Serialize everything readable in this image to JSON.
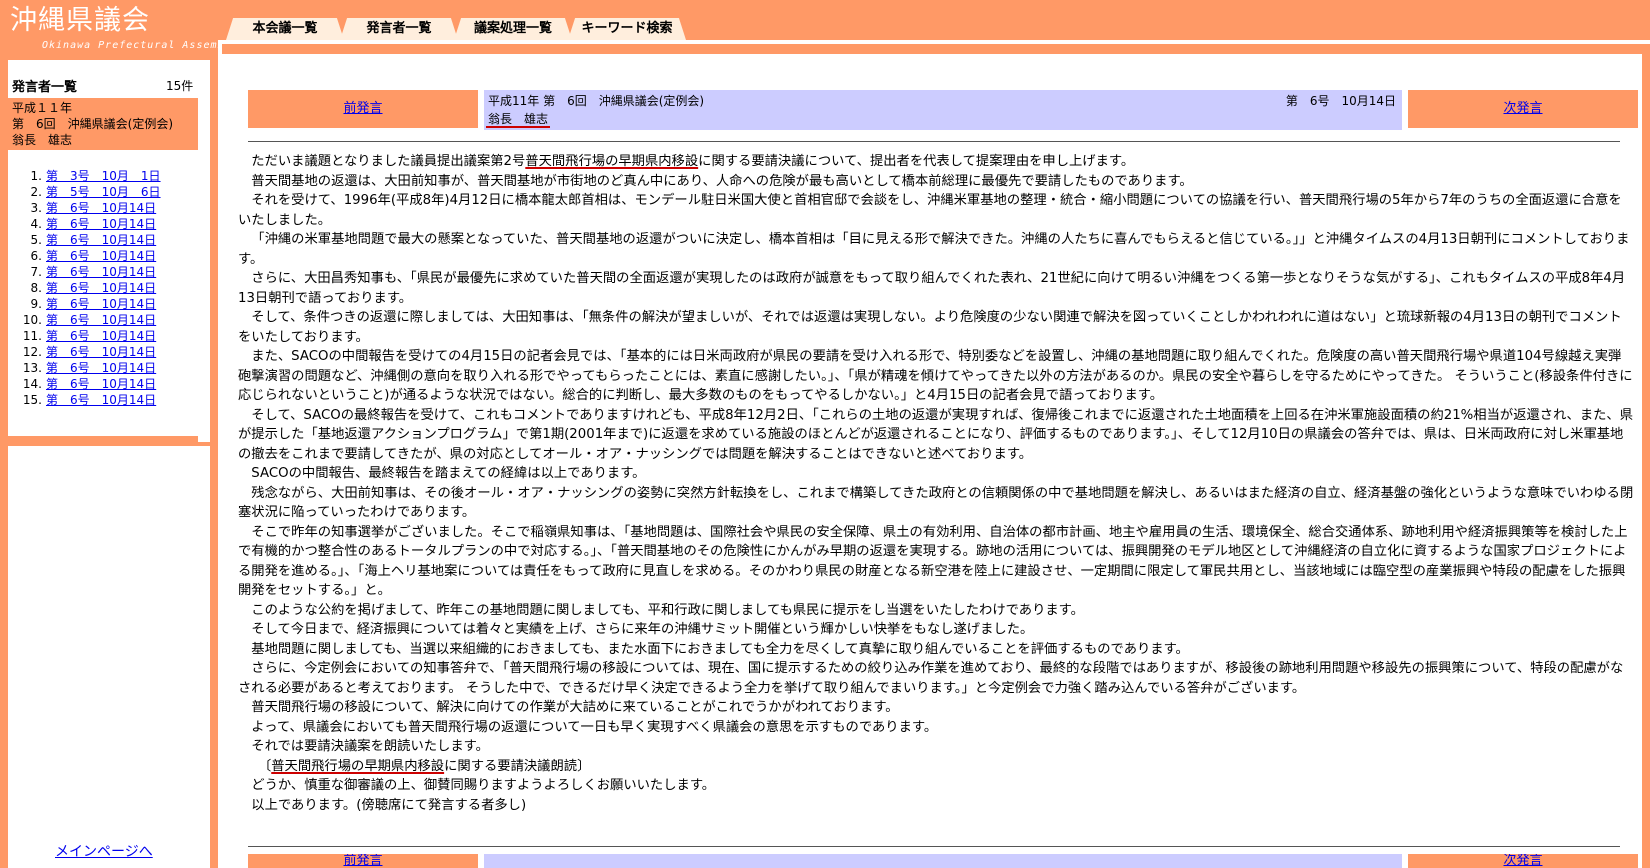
{
  "app": {
    "title": "沖縄県議会",
    "subtitle": "Okinawa Prefectural Assembly"
  },
  "tabs": [
    {
      "label": "本会議一覧"
    },
    {
      "label": "発言者一覧"
    },
    {
      "label": "議案処理一覧"
    },
    {
      "label": "キーワード検索"
    }
  ],
  "sidebar": {
    "heading": "発言者一覧",
    "count": "15件",
    "session_line1": "平成１１年",
    "session_line2": "第　6回　沖縄県議会(定例会)",
    "session_line3": "翁長　雄志",
    "items": [
      {
        "num": "1.",
        "label": "第　3号　10月　1日"
      },
      {
        "num": "2.",
        "label": "第　5号　10月　6日"
      },
      {
        "num": "3.",
        "label": "第　6号　10月14日"
      },
      {
        "num": "4.",
        "label": "第　6号　10月14日"
      },
      {
        "num": "5.",
        "label": "第　6号　10月14日"
      },
      {
        "num": "6.",
        "label": "第　6号　10月14日"
      },
      {
        "num": "7.",
        "label": "第　6号　10月14日"
      },
      {
        "num": "8.",
        "label": "第　6号　10月14日"
      },
      {
        "num": "9.",
        "label": "第　6号　10月14日"
      },
      {
        "num": "10.",
        "label": "第　6号　10月14日"
      },
      {
        "num": "11.",
        "label": "第　6号　10月14日"
      },
      {
        "num": "12.",
        "label": "第　6号　10月14日"
      },
      {
        "num": "13.",
        "label": "第　6号　10月14日"
      },
      {
        "num": "14.",
        "label": "第　6号　10月14日"
      },
      {
        "num": "15.",
        "label": "第　6号　10月14日"
      }
    ],
    "main_link": "メインページへ"
  },
  "nav": {
    "prev": "前発言",
    "next": "次発言",
    "session": "平成11年 第　6回　沖縄県議会(定例会)",
    "date": "第　6号　10月14日",
    "speaker": "翁長　雄志"
  },
  "speech": [
    "ただいま議題となりました議員提出議案第2号普天間飛行場の早期県内移設に関する要請決議について、提出者を代表して提案理由を申し上げます。",
    "普天間基地の返還は、大田前知事が、普天間基地が市街地のど真ん中にあり、人命への危険が最も高いとして橋本前総理に最優先で要請したものであります。",
    "それを受けて、1996年(平成8年)4月12日に橋本龍太郎首相は、モンデール駐日米国大使と首相官邸で会談をし、沖縄米軍基地の整理・統合・縮小問題についての協議を行い、普天間飛行場の5年から7年のうちの全面返還に合意をいたしました。",
    "「沖縄の米軍基地問題で最大の懸案となっていた、普天間基地の返還がついに決定し、橋本首相は「目に見える形で解決できた。沖縄の人たちに喜んでもらえると信じている。」」と沖縄タイムスの4月13日朝刊にコメントしております。",
    "さらに、大田昌秀知事も、「県民が最優先に求めていた普天間の全面返還が実現したのは政府が誠意をもって取り組んでくれた表れ、21世紀に向けて明るい沖縄をつくる第一歩となりそうな気がする」、これもタイムスの平成8年4月13日朝刊で語っております。",
    "そして、条件つきの返還に際しましては、大田知事は、「無条件の解決が望ましいが、それでは返還は実現しない。より危険度の少ない関連で解決を図っていくことしかわれわれに道はない」と琉球新報の4月13日の朝刊でコメントをいたしております。",
    "また、SACOの中間報告を受けての4月15日の記者会見では、「基本的には日米両政府が県民の要請を受け入れる形で、特別委などを設置し、沖縄の基地問題に取り組んでくれた。危険度の高い普天間飛行場や県道104号線越え実弾砲撃演習の問題など、沖縄側の意向を取り入れる形でやってもらったことには、素直に感謝したい。」、「県が精魂を傾けてやってきた以外の方法があるのか。県民の安全や暮らしを守るためにやってきた。 そういうこと(移設条件付きに応じられないということ)が通るような状況ではない。総合的に判断し、最大多数のものをもってやるしかない。」と4月15日の記者会見で語っております。",
    "そして、SACOの最終報告を受けて、これもコメントでありますけれども、平成8年12月2日、「これらの土地の返還が実現すれば、復帰後これまでに返還された土地面積を上回る在沖米軍施設面積の約21%相当が返還され、また、県が提示した「基地返還アクションプログラム」で第1期(2001年まで)に返還を求めている施設のほとんどが返還されることになり、評価するものであります。」、そして12月10日の県議会の答弁では、県は、日米両政府に対し米軍基地の撤去をこれまで要請してきたが、県の対応としてオール・オア・ナッシングでは問題を解決することはできないと述べております。",
    "SACOの中間報告、最終報告を踏まえての経緯は以上であります。",
    "残念ながら、大田前知事は、その後オール・オア・ナッシングの姿勢に突然方針転換をし、これまで構築してきた政府との信頼関係の中で基地問題を解決し、あるいはまた経済の自立、経済基盤の強化というような意味でいわゆる閉塞状況に陥っていったわけであります。",
    "そこで昨年の知事選挙がございました。そこで稲嶺県知事は、「基地問題は、国際社会や県民の安全保障、県土の有効利用、自治体の都市計画、地主や雇用員の生活、環境保全、総合交通体系、跡地利用や経済振興策等を検討した上で有機的かつ整合性のあるトータルプランの中で対応する。」、「普天間基地のその危険性にかんがみ早期の返還を実現する。跡地の活用については、振興開発のモデル地区として沖縄経済の自立化に資するような国家プロジェクトによる開発を進める。」、「海上ヘリ基地案については責任をもって政府に見直しを求める。そのかわり県民の財産となる新空港を陸上に建設させ、一定期間に限定して軍民共用とし、当該地域には臨空型の産業振興や特段の配慮をした振興開発をセットする。」と。",
    "このような公約を掲げまして、昨年この基地問題に関しましても、平和行政に関しましても県民に提示をし当選をいたしたわけであります。",
    "そして今日まで、経済振興については着々と実績を上げ、さらに来年の沖縄サミット開催という輝かしい快挙をもなし遂げました。",
    "基地問題に関しましても、当選以来組織的におきましても、また水面下におきましても全力を尽くして真摯に取り組んでいることを評価するものであります。",
    "さらに、今定例会においての知事答弁で、「普天間飛行場の移設については、現在、国に提示するための絞り込み作業を進めており、最終的な段階ではありますが、移設後の跡地利用問題や移設先の振興策について、特段の配慮がなされる必要があると考えております。 そうした中で、できるだけ早く決定できるよう全力を挙げて取り組んでまいります。」と今定例会で力強く踏み込んでいる答弁がございます。",
    "普天間飛行場の移設について、解決に向けての作業が大詰めに来ていることがこれでうかがわれております。",
    "よって、県議会においても普天間飛行場の返還について一日も早く実現すべく県議会の意思を示すものであります。",
    "それでは要請決議案を朗読いたします。",
    "　〔普天間飛行場の早期県内移設に関する要請決議朗読〕",
    "どうか、慎重な御審議の上、御賛同賜りますようよろしくお願いいたします。",
    "以上であります。(傍聴席にて発言する者多し)"
  ]
}
